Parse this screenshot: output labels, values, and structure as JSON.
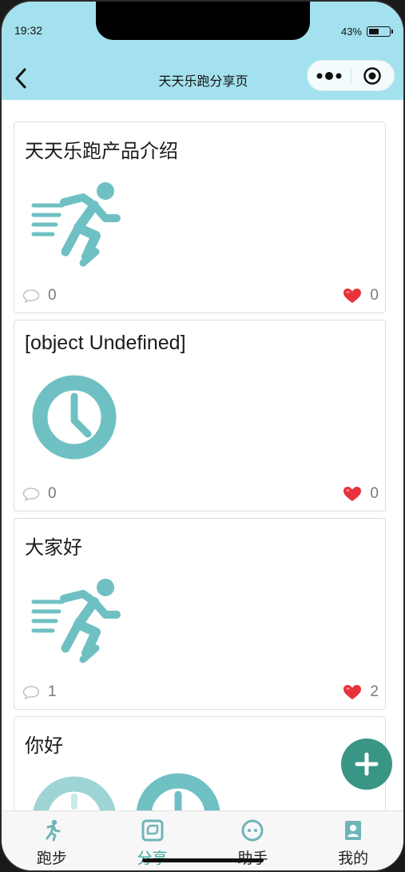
{
  "status_bar": {
    "time": "19:32",
    "battery": "43%"
  },
  "nav": {
    "title": "天天乐跑分享页"
  },
  "posts": [
    {
      "title": "天天乐跑产品介绍",
      "image": "runner-icon",
      "comments": "0",
      "likes": "0"
    },
    {
      "title": "[object Undefined]",
      "image": "clock-icon",
      "comments": "0",
      "likes": "0"
    },
    {
      "title": "大家好",
      "image": "runner-icon",
      "comments": "1",
      "likes": "2"
    },
    {
      "title": "你好",
      "image": "clock-icon"
    }
  ],
  "tabs": [
    {
      "label": "跑步",
      "icon": "run-icon"
    },
    {
      "label": "分享",
      "icon": "share-icon",
      "active": true
    },
    {
      "label": "助手",
      "icon": "assistant-icon"
    },
    {
      "label": "我的",
      "icon": "profile-icon"
    }
  ],
  "colors": {
    "header": "#a4e1ee",
    "accent": "#3a9684",
    "icon_teal": "#6fc0c3",
    "active_tab": "#3aa89a",
    "heart": "#e8323c"
  }
}
